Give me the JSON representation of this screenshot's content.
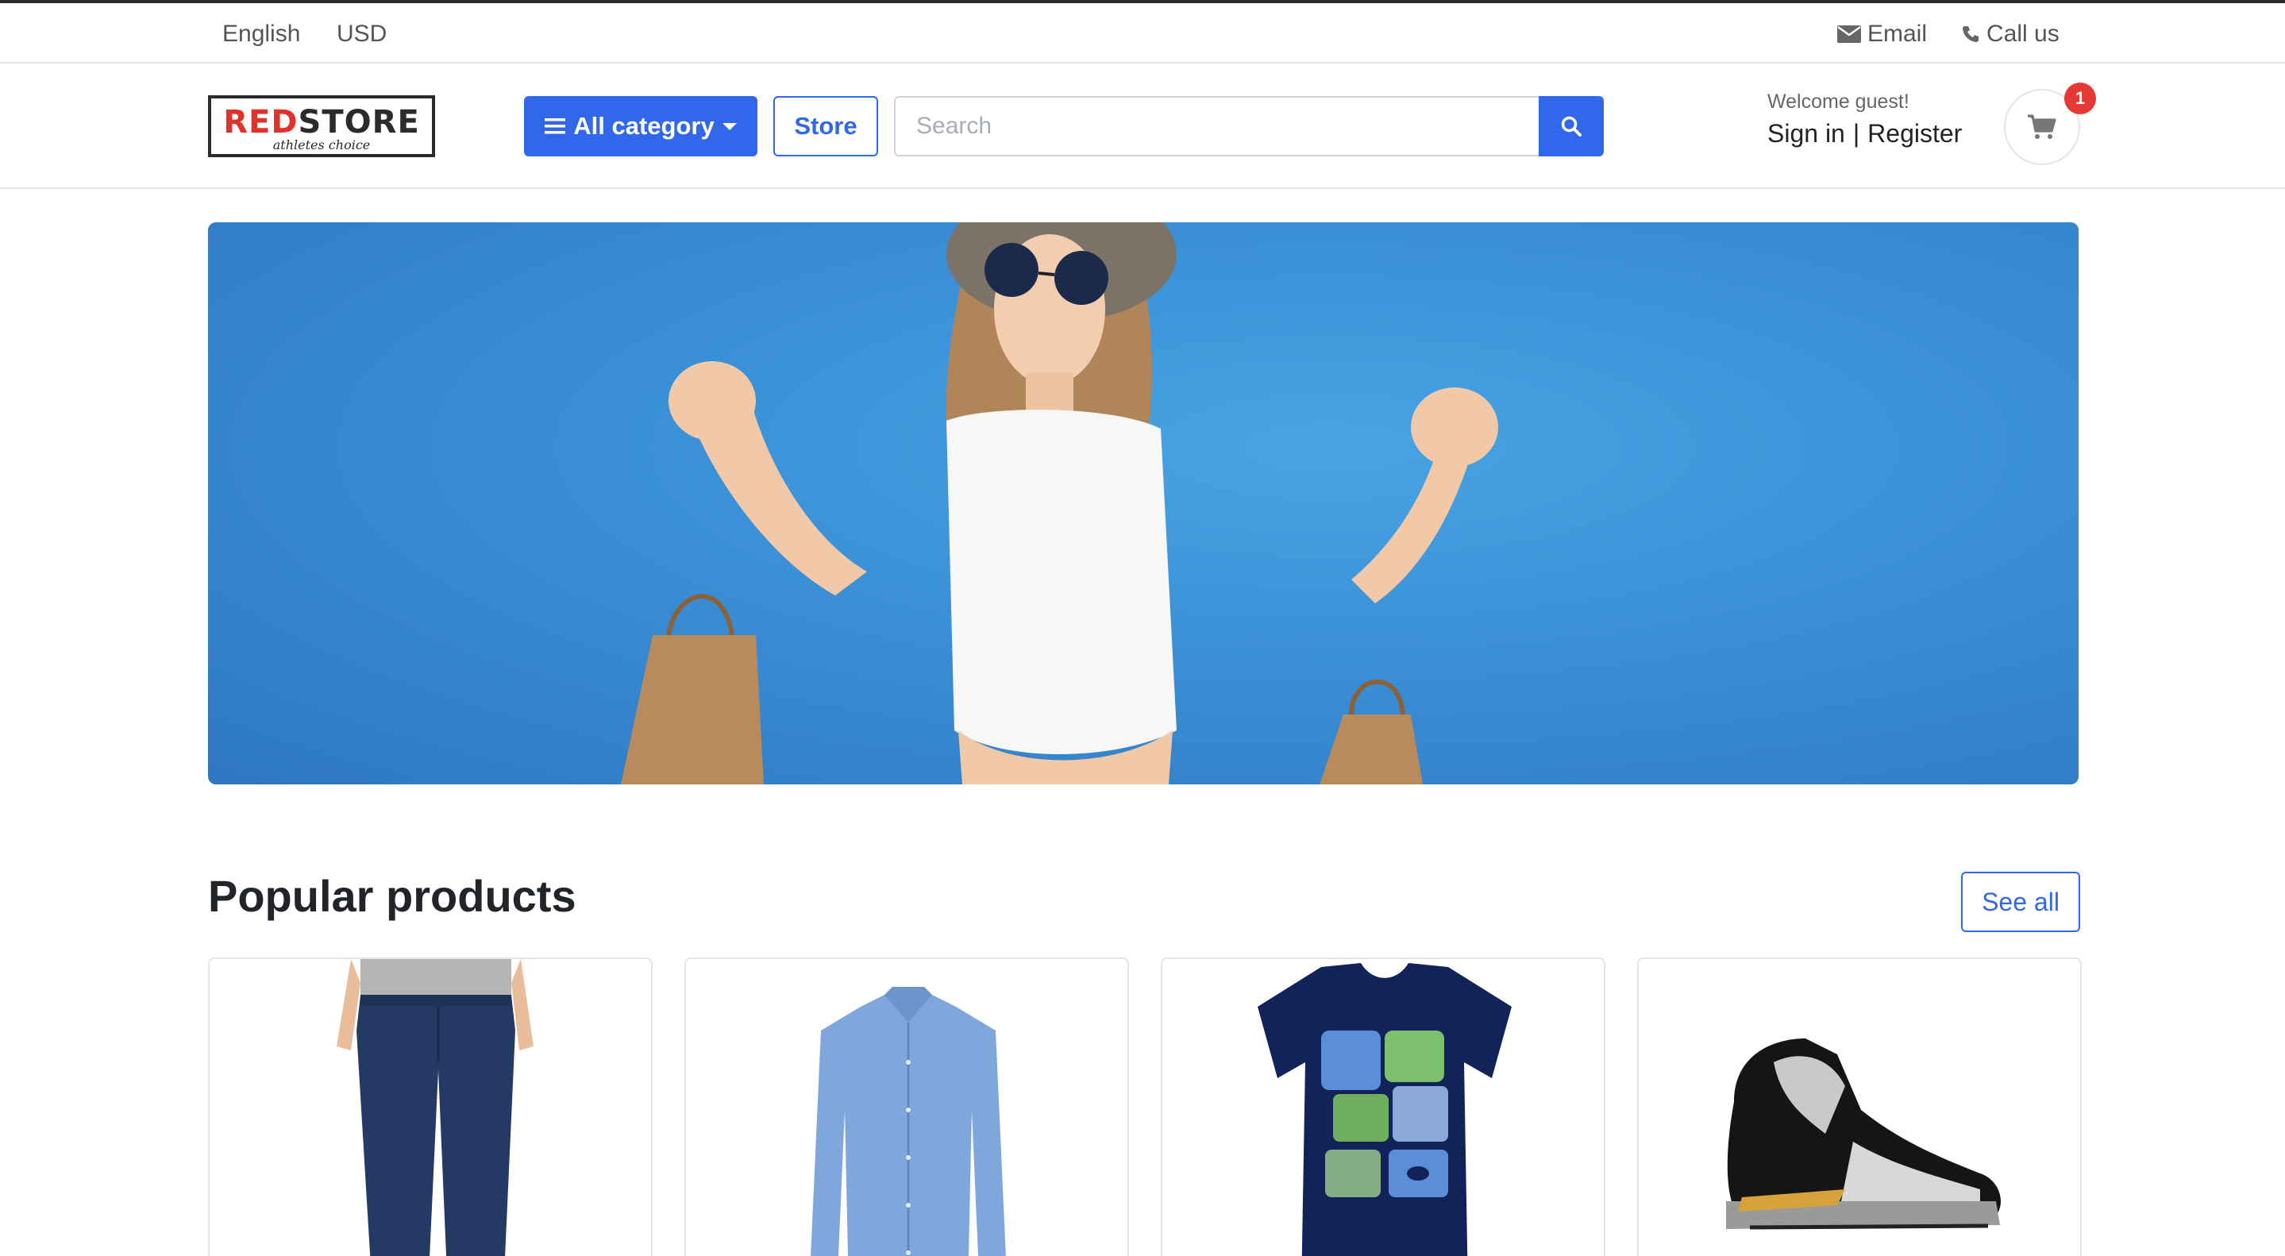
{
  "topbar": {
    "language": "English",
    "currency": "USD",
    "email_label": "Email",
    "call_label": "Call us"
  },
  "header": {
    "logo_word_red": "RED",
    "logo_word_dark": "STORE",
    "logo_tagline": "athletes choice",
    "category_button": "All category",
    "store_button": "Store",
    "search_placeholder": "Search",
    "welcome_text": "Welcome guest!",
    "sign_in": "Sign in",
    "separator": "|",
    "register": "Register",
    "cart_count": "1"
  },
  "main": {
    "section_title": "Popular products",
    "see_all": "See all",
    "products": [
      {
        "image": "jeans"
      },
      {
        "image": "shirt"
      },
      {
        "image": "tshirt"
      },
      {
        "image": "sneaker"
      }
    ]
  },
  "colors": {
    "primary": "#3167eb",
    "badge": "#e53935",
    "banner_blue": "#3a8fd6",
    "logo_red": "#e0322b"
  },
  "icons": [
    "envelope-icon",
    "phone-icon",
    "hamburger-icon",
    "caret-down-icon",
    "search-icon",
    "cart-icon"
  ]
}
